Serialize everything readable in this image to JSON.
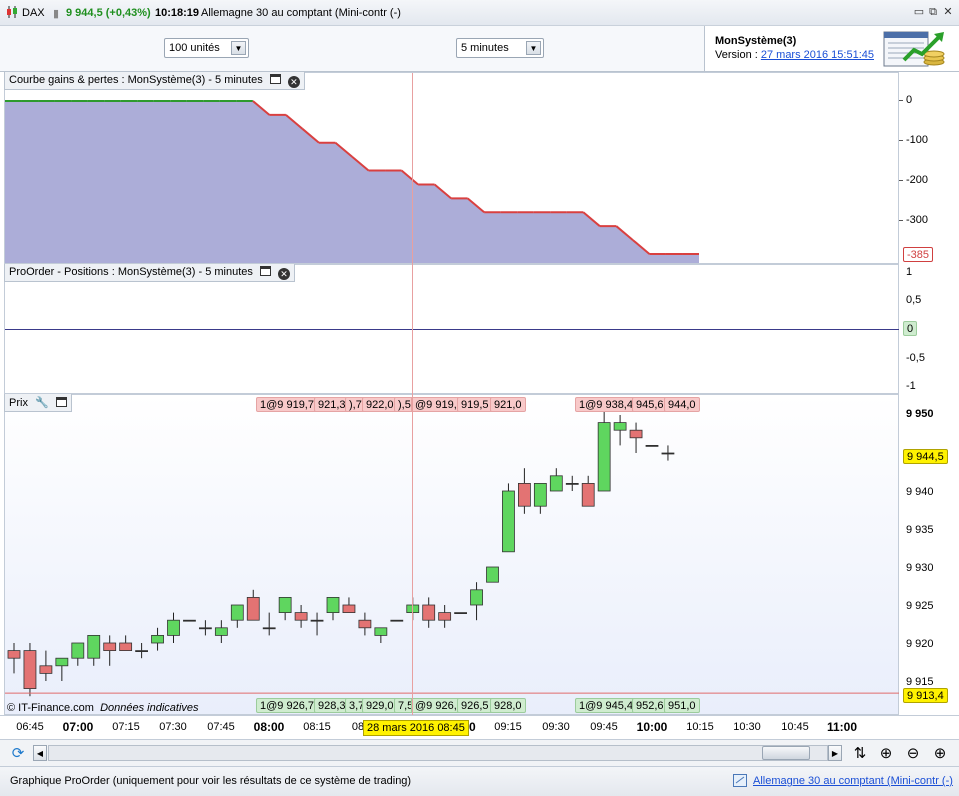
{
  "titlebar": {
    "symbol": "DAX",
    "price_change": "9 944,5 (+0,43%)",
    "time": "10:18:19",
    "instrument": "Allemagne 30 au comptant (Mini-contr (-)",
    "controls": {
      "minimize": "▭",
      "restore": "⧉",
      "close": "✕"
    }
  },
  "toolbar": {
    "units": "100 unités",
    "interval": "5 minutes"
  },
  "system": {
    "name": "MonSystème(3)",
    "version_label": "Version : ",
    "version_date": "27 mars 2016 15:51:45"
  },
  "panels": {
    "equity": {
      "title": "Courbe gains & pertes : MonSystème(3) - 5 minutes",
      "yticks": [
        "0",
        "-100",
        "-200",
        "-300"
      ],
      "last_value": "-385"
    },
    "positions": {
      "title": "ProOrder - Positions : MonSystème(3) - 5 minutes",
      "yticks": [
        "1",
        "0,5",
        "-0,5",
        "-1"
      ],
      "last_value": "0"
    },
    "price": {
      "title": "Prix",
      "yticks": [
        "9 950",
        "9 940",
        "9 935",
        "9 930",
        "9 925",
        "9 920",
        "9 915"
      ],
      "current_price": "9 944,5",
      "low_line_price": "9 913,4",
      "copyright": "© IT-Finance.com",
      "disclaimer": "Données indicatives",
      "top_labels_1": [
        "1@9 919,7",
        "921,3",
        "),7",
        "922,0",
        "),5"
      ],
      "top_labels_2": [
        "@9 919,5",
        "919,5",
        "921,0"
      ],
      "top_labels_3": [
        "1@9 938,4",
        "945,6",
        "944,0"
      ],
      "bottom_labels_1": [
        "1@9 926,7",
        "928,3",
        "3,7",
        "929,0",
        "7,5"
      ],
      "bottom_labels_2": [
        "@9 926,5",
        "926,5",
        "928,0"
      ],
      "bottom_labels_3": [
        "1@9 945,4",
        "952,6",
        "951,0"
      ]
    }
  },
  "xaxis": {
    "labels": [
      "06:45",
      "07:00",
      "07:15",
      "07:30",
      "07:45",
      "08:00",
      "08:15",
      "08",
      "00",
      "09:15",
      "09:30",
      "09:45",
      "10:00",
      "10:15",
      "10:30",
      "10:45",
      "11:00"
    ],
    "cursor_date": "28 mars 2016 08:45"
  },
  "status": {
    "left": "Graphique ProOrder (uniquement pour voir les résultats de ce système de trading)",
    "right": "Allemagne 30 au comptant (Mini-contr (-)"
  },
  "colors": {
    "equity_fill": "#a8a9d6",
    "equity_line_up": "#2e9a2e",
    "equity_line_down": "#d94040",
    "bull_candle": "#5fd65f",
    "bear_candle": "#e37373",
    "price_bg": "#e9eefb",
    "cursor_line": "#e8a0a0"
  },
  "chart_data": {
    "type": "line",
    "title": "Courbe gains & pertes : MonSystème(3) - 5 minutes",
    "x": [
      "06:45",
      "06:50",
      "06:55",
      "07:00",
      "07:05",
      "07:10",
      "07:15",
      "07:20",
      "07:25",
      "07:30",
      "07:35",
      "07:40",
      "07:45",
      "07:50",
      "07:55",
      "08:00",
      "08:05",
      "08:10",
      "08:15",
      "08:20",
      "08:25",
      "08:30",
      "08:35",
      "08:40",
      "08:45",
      "08:50",
      "08:55",
      "09:00",
      "09:05",
      "09:10",
      "09:15",
      "09:20",
      "09:25",
      "09:30",
      "09:35",
      "09:40",
      "09:45",
      "09:50",
      "09:55",
      "10:00",
      "10:05",
      "10:10",
      "10:15"
    ],
    "series": [
      {
        "values": [
          0,
          0,
          0,
          0,
          0,
          0,
          0,
          0,
          0,
          0,
          0,
          0,
          0,
          0,
          0,
          0,
          -35,
          -35,
          -70,
          -105,
          -105,
          -140,
          -175,
          -175,
          -175,
          -210,
          -210,
          -245,
          -245,
          -280,
          -280,
          -280,
          -280,
          -280,
          -280,
          -280,
          -315,
          -315,
          -350,
          -385,
          -385,
          -385,
          -385
        ]
      }
    ],
    "ylim": [
      -385,
      20
    ],
    "candles": [
      {
        "o": 9919,
        "h": 9920,
        "l": 9916,
        "c": 9918
      },
      {
        "o": 9919,
        "h": 9920,
        "l": 9913,
        "c": 9914
      },
      {
        "o": 9917,
        "h": 9919,
        "l": 9915,
        "c": 9916
      },
      {
        "o": 9917,
        "h": 9918,
        "l": 9915,
        "c": 9918
      },
      {
        "o": 9918,
        "h": 9920,
        "l": 9917,
        "c": 9920
      },
      {
        "o": 9918,
        "h": 9921,
        "l": 9917,
        "c": 9921
      },
      {
        "o": 9920,
        "h": 9921,
        "l": 9917,
        "c": 9919
      },
      {
        "o": 9920,
        "h": 9921,
        "l": 9919,
        "c": 9919
      },
      {
        "o": 9919,
        "h": 9920,
        "l": 9918,
        "c": 9919
      },
      {
        "o": 9920,
        "h": 9922,
        "l": 9919,
        "c": 9921
      },
      {
        "o": 9921,
        "h": 9924,
        "l": 9920,
        "c": 9923
      },
      {
        "o": 9923,
        "h": 9923,
        "l": 9923,
        "c": 9923
      },
      {
        "o": 9922,
        "h": 9923,
        "l": 9921,
        "c": 9922
      },
      {
        "o": 9921,
        "h": 9923,
        "l": 9920,
        "c": 9922
      },
      {
        "o": 9923,
        "h": 9925,
        "l": 9922,
        "c": 9925
      },
      {
        "o": 9926,
        "h": 9927,
        "l": 9923,
        "c": 9923
      },
      {
        "o": 9922,
        "h": 9924,
        "l": 9921,
        "c": 9922
      },
      {
        "o": 9924,
        "h": 9926,
        "l": 9923,
        "c": 9926
      },
      {
        "o": 9924,
        "h": 9925,
        "l": 9922,
        "c": 9923
      },
      {
        "o": 9923,
        "h": 9924,
        "l": 9921,
        "c": 9923
      },
      {
        "o": 9924,
        "h": 9926,
        "l": 9923,
        "c": 9926
      },
      {
        "o": 9925,
        "h": 9926,
        "l": 9924,
        "c": 9924
      },
      {
        "o": 9923,
        "h": 9924,
        "l": 9921,
        "c": 9922
      },
      {
        "o": 9921,
        "h": 9922,
        "l": 9920,
        "c": 9922
      },
      {
        "o": 9923,
        "h": 9923,
        "l": 9923,
        "c": 9923
      },
      {
        "o": 9924,
        "h": 9926,
        "l": 9923,
        "c": 9925
      },
      {
        "o": 9925,
        "h": 9926,
        "l": 9922,
        "c": 9923
      },
      {
        "o": 9924,
        "h": 9925,
        "l": 9922,
        "c": 9923
      },
      {
        "o": 9924,
        "h": 9924,
        "l": 9924,
        "c": 9924
      },
      {
        "o": 9925,
        "h": 9928,
        "l": 9923,
        "c": 9927
      },
      {
        "o": 9928,
        "h": 9930,
        "l": 9928,
        "c": 9930
      },
      {
        "o": 9932,
        "h": 9941,
        "l": 9932,
        "c": 9940
      },
      {
        "o": 9941,
        "h": 9943,
        "l": 9937,
        "c": 9938
      },
      {
        "o": 9938,
        "h": 9941,
        "l": 9937,
        "c": 9941
      },
      {
        "o": 9940,
        "h": 9943,
        "l": 9940,
        "c": 9942
      },
      {
        "o": 9941,
        "h": 9942,
        "l": 9940,
        "c": 9941
      },
      {
        "o": 9941,
        "h": 9942,
        "l": 9938,
        "c": 9938
      },
      {
        "o": 9940,
        "h": 9952,
        "l": 9940,
        "c": 9949
      },
      {
        "o": 9948,
        "h": 9950,
        "l": 9946,
        "c": 9949
      },
      {
        "o": 9948,
        "h": 9949,
        "l": 9945,
        "c": 9947
      },
      {
        "o": 9946,
        "h": 9946,
        "l": 9946,
        "c": 9946
      },
      {
        "o": 9945,
        "h": 9946,
        "l": 9944,
        "c": 9945
      }
    ],
    "price_ylim": [
      9912,
      9952
    ]
  }
}
